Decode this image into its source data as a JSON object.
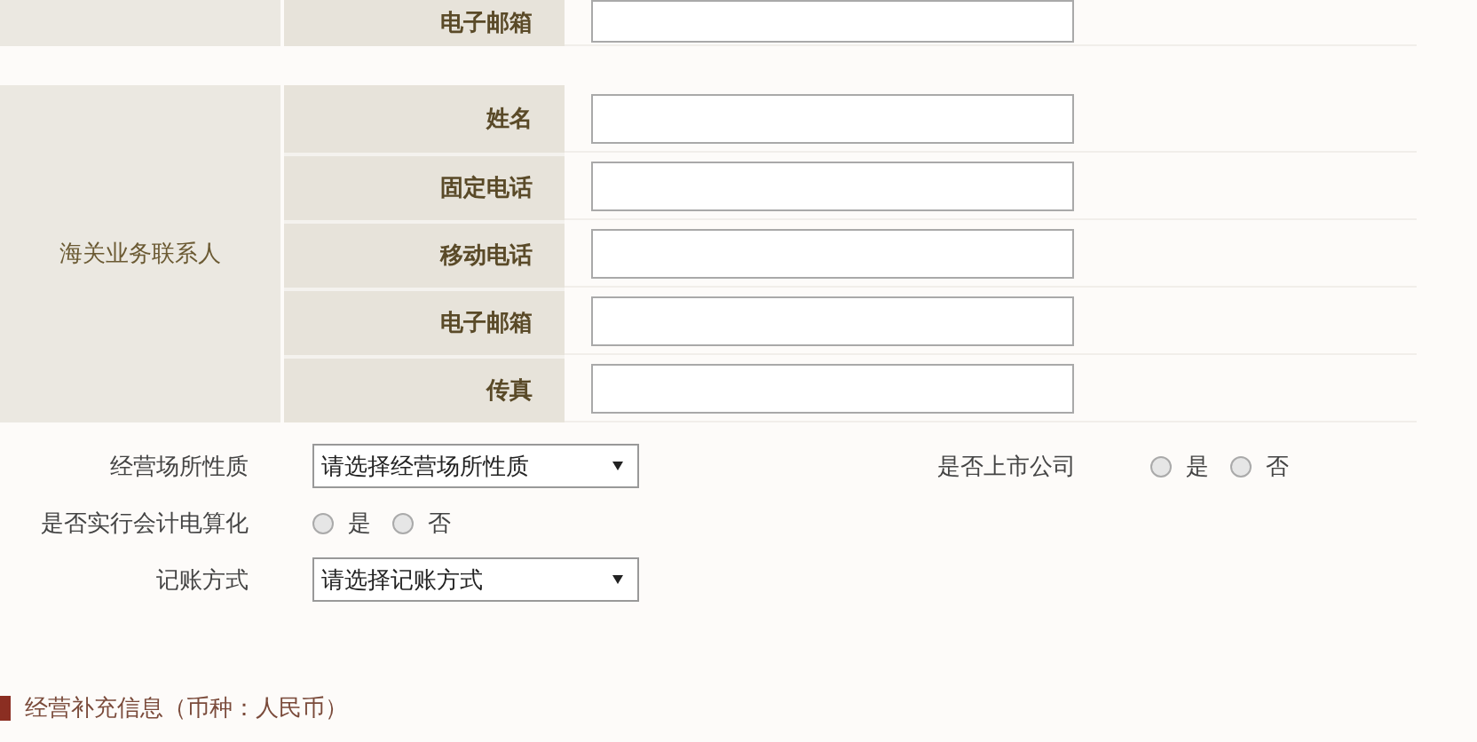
{
  "top_row": {
    "label": "电子邮箱"
  },
  "contact_group": {
    "label": "海关业务联系人",
    "fields": [
      {
        "label": "姓名"
      },
      {
        "label": "固定电话"
      },
      {
        "label": "移动电话"
      },
      {
        "label": "电子邮箱"
      },
      {
        "label": "传真"
      }
    ]
  },
  "form_rows": [
    {
      "items": [
        {
          "kind": "select",
          "label": "经营场所性质",
          "value": "请选择经营场所性质"
        },
        {
          "kind": "radio",
          "label": "是否上市公司",
          "options": [
            {
              "label": "是",
              "selected": false
            },
            {
              "label": "否",
              "selected": false
            }
          ]
        }
      ]
    },
    {
      "items": [
        {
          "kind": "radio",
          "label": "是否实行会计电算化",
          "options": [
            {
              "label": "是",
              "selected": false
            },
            {
              "label": "否",
              "selected": false
            }
          ]
        }
      ]
    },
    {
      "items": [
        {
          "kind": "select",
          "label": "记账方式",
          "value": "请选择记账方式"
        }
      ]
    }
  ],
  "section_header": "经营补充信息（币种：人民币）"
}
